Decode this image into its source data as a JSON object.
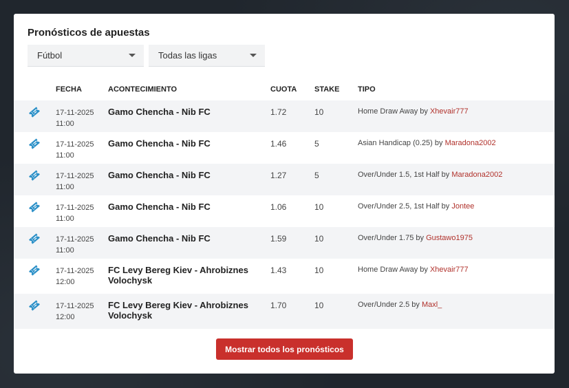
{
  "widget": {
    "title": "Pronósticos de apuestas",
    "sport_select": "Fútbol",
    "league_select": "Todas las ligas",
    "show_all_button": "Mostrar todos los pronósticos"
  },
  "table": {
    "headers": {
      "date": "FECHA",
      "event": "ACONTECIMIENTO",
      "odds": "CUOTA",
      "stake": "STAKE",
      "type": "TIPO"
    },
    "rows": [
      {
        "date": "17-11-2025",
        "time": "11:00",
        "event": "Gamo Chencha - Nib FC",
        "odds": "1.72",
        "stake": "10",
        "type": "Home Draw Away",
        "by": "by",
        "user": "Xhevair777"
      },
      {
        "date": "17-11-2025",
        "time": "11:00",
        "event": "Gamo Chencha - Nib FC",
        "odds": "1.46",
        "stake": "5",
        "type": "Asian Handicap (0.25)",
        "by": "by",
        "user": "Maradona2002"
      },
      {
        "date": "17-11-2025",
        "time": "11:00",
        "event": "Gamo Chencha - Nib FC",
        "odds": "1.27",
        "stake": "5",
        "type": "Over/Under 1.5, 1st Half",
        "by": "by",
        "user": "Maradona2002"
      },
      {
        "date": "17-11-2025",
        "time": "11:00",
        "event": "Gamo Chencha - Nib FC",
        "odds": "1.06",
        "stake": "10",
        "type": "Over/Under 2.5, 1st Half",
        "by": "by",
        "user": "Jontee"
      },
      {
        "date": "17-11-2025",
        "time": "11:00",
        "event": "Gamo Chencha - Nib FC",
        "odds": "1.59",
        "stake": "10",
        "type": "Over/Under 1.75",
        "by": "by",
        "user": "Gustawo1975"
      },
      {
        "date": "17-11-2025",
        "time": "12:00",
        "event": "FC Levy Bereg Kiev - Ahrobiznes Volochysk",
        "odds": "1.43",
        "stake": "10",
        "type": "Home Draw Away",
        "by": "by",
        "user": "Xhevair777"
      },
      {
        "date": "17-11-2025",
        "time": "12:00",
        "event": "FC Levy Bereg Kiev - Ahrobiznes Volochysk",
        "odds": "1.70",
        "stake": "10",
        "type": "Over/Under 2.5",
        "by": "by",
        "user": "Maxl_"
      }
    ]
  },
  "icons": {
    "row_icon": "ticket-icon",
    "select_caret": "caret-down-icon"
  },
  "colors": {
    "accent": "#c9302c",
    "link": "#b0302a",
    "ticket_icon": "#2a8fc7",
    "row_shade": "#f3f4f6"
  }
}
